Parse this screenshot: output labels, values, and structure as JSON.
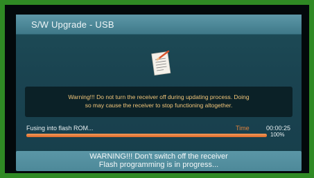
{
  "dialog": {
    "title": "S/W Upgrade - USB"
  },
  "icons": {
    "document": "document-edit-icon"
  },
  "warning": {
    "line1": "Warning!!! Do not turn the receiver off during updating process. Doing",
    "line2": "so may cause the receiver to stop functioning altogether."
  },
  "progress": {
    "status": "Fusing into flash ROM...",
    "time_label": "Time",
    "time_value": "00:00:25",
    "percent_label": "100%",
    "fraction": 1.0
  },
  "footer": {
    "line1": "WARNING!!! Don't switch off the receiver",
    "line2": "Flash programming is in progress..."
  },
  "colors": {
    "background": "#2f8a24",
    "panel": "#1a4350",
    "title_bar": "#4c8797",
    "warning_text": "#f2c67a",
    "progress_fill": "#de6b2b",
    "time_label": "#e0823c"
  }
}
